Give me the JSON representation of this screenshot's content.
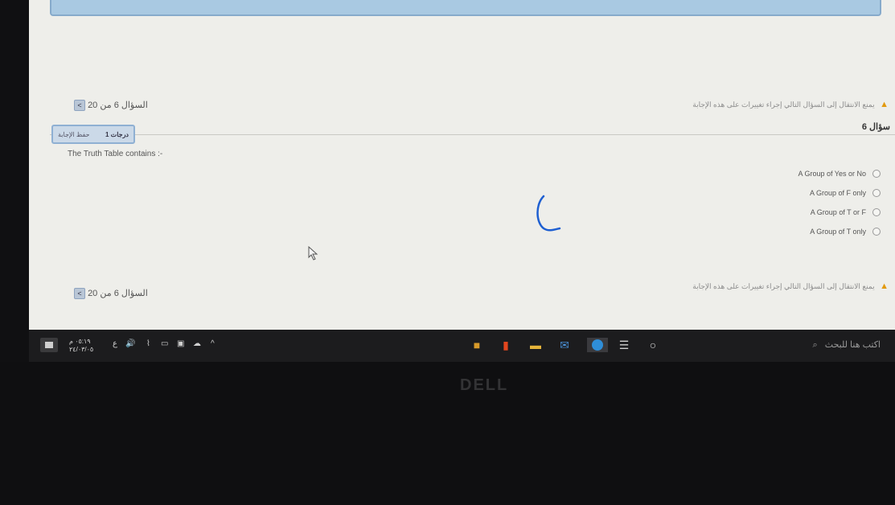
{
  "nav": {
    "top_label": "السؤال 6 من 20",
    "bottom_label": "السؤال 6 من 20",
    "next_arrow": "<"
  },
  "warning": {
    "top_text": "يمنع الانتقال إلى السؤال التالي إجراء تغييرات على هذه الإجابة",
    "bottom_text": "يمنع الانتقال إلى السؤال التالي إجراء تغييرات على هذه الإجابة",
    "icon": "warning-triangle-icon"
  },
  "question": {
    "title": "سؤال 6",
    "grade": "1 درجات",
    "save_label": "حفظ الإجابة",
    "text": "The Truth Table contains :-",
    "options": [
      "A Group of Yes or No",
      "A Group of F only",
      "A Group of T or F",
      "A Group of T only"
    ]
  },
  "taskbar": {
    "search_placeholder": "اكتب هنا للبحث",
    "time": "٠٥:١٩ م",
    "date": "٢٤/٠٣/٠٥",
    "lang": "ع"
  },
  "brand": "DELL",
  "colors": {
    "accent": "#a9c9e2",
    "spinner": "#1e5fd1",
    "warning": "#e29a10"
  }
}
